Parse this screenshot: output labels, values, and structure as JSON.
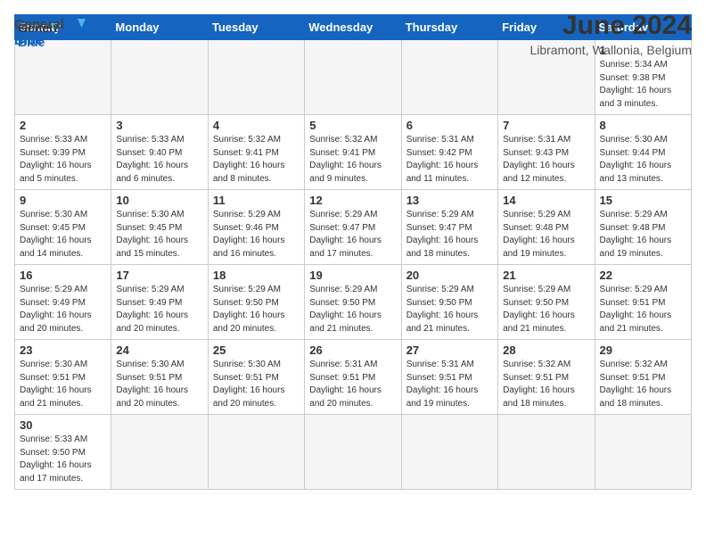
{
  "logo": {
    "line1": "General",
    "line2": "Blue"
  },
  "title": "June 2024",
  "subtitle": "Libramont, Wallonia, Belgium",
  "days_of_week": [
    "Sunday",
    "Monday",
    "Tuesday",
    "Wednesday",
    "Thursday",
    "Friday",
    "Saturday"
  ],
  "weeks": [
    [
      {
        "day": "",
        "info": "",
        "empty": true
      },
      {
        "day": "",
        "info": "",
        "empty": true
      },
      {
        "day": "",
        "info": "",
        "empty": true
      },
      {
        "day": "",
        "info": "",
        "empty": true
      },
      {
        "day": "",
        "info": "",
        "empty": true
      },
      {
        "day": "",
        "info": "",
        "empty": true
      },
      {
        "day": "1",
        "info": "Sunrise: 5:34 AM\nSunset: 9:38 PM\nDaylight: 16 hours\nand 3 minutes.",
        "empty": false
      }
    ],
    [
      {
        "day": "2",
        "info": "Sunrise: 5:33 AM\nSunset: 9:39 PM\nDaylight: 16 hours\nand 5 minutes.",
        "empty": false
      },
      {
        "day": "3",
        "info": "Sunrise: 5:33 AM\nSunset: 9:40 PM\nDaylight: 16 hours\nand 6 minutes.",
        "empty": false
      },
      {
        "day": "4",
        "info": "Sunrise: 5:32 AM\nSunset: 9:41 PM\nDaylight: 16 hours\nand 8 minutes.",
        "empty": false
      },
      {
        "day": "5",
        "info": "Sunrise: 5:32 AM\nSunset: 9:41 PM\nDaylight: 16 hours\nand 9 minutes.",
        "empty": false
      },
      {
        "day": "6",
        "info": "Sunrise: 5:31 AM\nSunset: 9:42 PM\nDaylight: 16 hours\nand 11 minutes.",
        "empty": false
      },
      {
        "day": "7",
        "info": "Sunrise: 5:31 AM\nSunset: 9:43 PM\nDaylight: 16 hours\nand 12 minutes.",
        "empty": false
      },
      {
        "day": "8",
        "info": "Sunrise: 5:30 AM\nSunset: 9:44 PM\nDaylight: 16 hours\nand 13 minutes.",
        "empty": false
      }
    ],
    [
      {
        "day": "9",
        "info": "Sunrise: 5:30 AM\nSunset: 9:45 PM\nDaylight: 16 hours\nand 14 minutes.",
        "empty": false
      },
      {
        "day": "10",
        "info": "Sunrise: 5:30 AM\nSunset: 9:45 PM\nDaylight: 16 hours\nand 15 minutes.",
        "empty": false
      },
      {
        "day": "11",
        "info": "Sunrise: 5:29 AM\nSunset: 9:46 PM\nDaylight: 16 hours\nand 16 minutes.",
        "empty": false
      },
      {
        "day": "12",
        "info": "Sunrise: 5:29 AM\nSunset: 9:47 PM\nDaylight: 16 hours\nand 17 minutes.",
        "empty": false
      },
      {
        "day": "13",
        "info": "Sunrise: 5:29 AM\nSunset: 9:47 PM\nDaylight: 16 hours\nand 18 minutes.",
        "empty": false
      },
      {
        "day": "14",
        "info": "Sunrise: 5:29 AM\nSunset: 9:48 PM\nDaylight: 16 hours\nand 19 minutes.",
        "empty": false
      },
      {
        "day": "15",
        "info": "Sunrise: 5:29 AM\nSunset: 9:48 PM\nDaylight: 16 hours\nand 19 minutes.",
        "empty": false
      }
    ],
    [
      {
        "day": "16",
        "info": "Sunrise: 5:29 AM\nSunset: 9:49 PM\nDaylight: 16 hours\nand 20 minutes.",
        "empty": false
      },
      {
        "day": "17",
        "info": "Sunrise: 5:29 AM\nSunset: 9:49 PM\nDaylight: 16 hours\nand 20 minutes.",
        "empty": false
      },
      {
        "day": "18",
        "info": "Sunrise: 5:29 AM\nSunset: 9:50 PM\nDaylight: 16 hours\nand 20 minutes.",
        "empty": false
      },
      {
        "day": "19",
        "info": "Sunrise: 5:29 AM\nSunset: 9:50 PM\nDaylight: 16 hours\nand 21 minutes.",
        "empty": false
      },
      {
        "day": "20",
        "info": "Sunrise: 5:29 AM\nSunset: 9:50 PM\nDaylight: 16 hours\nand 21 minutes.",
        "empty": false
      },
      {
        "day": "21",
        "info": "Sunrise: 5:29 AM\nSunset: 9:50 PM\nDaylight: 16 hours\nand 21 minutes.",
        "empty": false
      },
      {
        "day": "22",
        "info": "Sunrise: 5:29 AM\nSunset: 9:51 PM\nDaylight: 16 hours\nand 21 minutes.",
        "empty": false
      }
    ],
    [
      {
        "day": "23",
        "info": "Sunrise: 5:30 AM\nSunset: 9:51 PM\nDaylight: 16 hours\nand 21 minutes.",
        "empty": false
      },
      {
        "day": "24",
        "info": "Sunrise: 5:30 AM\nSunset: 9:51 PM\nDaylight: 16 hours\nand 20 minutes.",
        "empty": false
      },
      {
        "day": "25",
        "info": "Sunrise: 5:30 AM\nSunset: 9:51 PM\nDaylight: 16 hours\nand 20 minutes.",
        "empty": false
      },
      {
        "day": "26",
        "info": "Sunrise: 5:31 AM\nSunset: 9:51 PM\nDaylight: 16 hours\nand 20 minutes.",
        "empty": false
      },
      {
        "day": "27",
        "info": "Sunrise: 5:31 AM\nSunset: 9:51 PM\nDaylight: 16 hours\nand 19 minutes.",
        "empty": false
      },
      {
        "day": "28",
        "info": "Sunrise: 5:32 AM\nSunset: 9:51 PM\nDaylight: 16 hours\nand 18 minutes.",
        "empty": false
      },
      {
        "day": "29",
        "info": "Sunrise: 5:32 AM\nSunset: 9:51 PM\nDaylight: 16 hours\nand 18 minutes.",
        "empty": false
      }
    ],
    [
      {
        "day": "30",
        "info": "Sunrise: 5:33 AM\nSunset: 9:50 PM\nDaylight: 16 hours\nand 17 minutes.",
        "empty": false
      },
      {
        "day": "",
        "info": "",
        "empty": true
      },
      {
        "day": "",
        "info": "",
        "empty": true
      },
      {
        "day": "",
        "info": "",
        "empty": true
      },
      {
        "day": "",
        "info": "",
        "empty": true
      },
      {
        "day": "",
        "info": "",
        "empty": true
      },
      {
        "day": "",
        "info": "",
        "empty": true
      }
    ]
  ]
}
